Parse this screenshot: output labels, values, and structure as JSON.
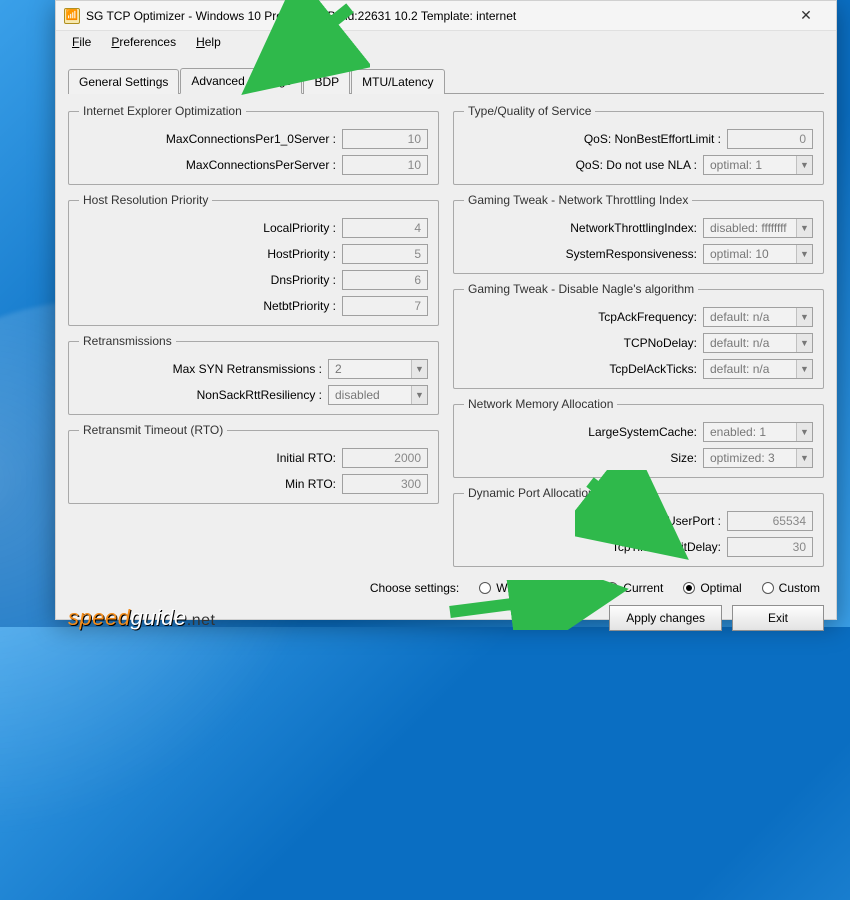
{
  "title": "SG TCP Optimizer - Windows 10 Pro (64-bit) Build:22631 10.2  Template: internet",
  "menu": {
    "file": "File",
    "preferences": "Preferences",
    "help": "Help"
  },
  "tabs": {
    "general": "General Settings",
    "advanced": "Advanced Settings",
    "bdp": "BDP",
    "mtu": "MTU/Latency"
  },
  "ie": {
    "legend": "Internet Explorer Optimization",
    "maxconn10_label": "MaxConnectionsPer1_0Server :",
    "maxconn10_value": "10",
    "maxconn_label": "MaxConnectionsPerServer :",
    "maxconn_value": "10"
  },
  "hrp": {
    "legend": "Host Resolution Priority",
    "local_label": "LocalPriority :",
    "local_value": "4",
    "host_label": "HostPriority :",
    "host_value": "5",
    "dns_label": "DnsPriority :",
    "dns_value": "6",
    "netbt_label": "NetbtPriority :",
    "netbt_value": "7"
  },
  "retr": {
    "legend": "Retransmissions",
    "maxsyn_label": "Max SYN Retransmissions :",
    "maxsyn_value": "2",
    "nonsack_label": "NonSackRttResiliency :",
    "nonsack_value": "disabled"
  },
  "rto": {
    "legend": "Retransmit Timeout (RTO)",
    "init_label": "Initial RTO:",
    "init_value": "2000",
    "min_label": "Min RTO:",
    "min_value": "300"
  },
  "qos": {
    "legend": "Type/Quality of Service",
    "nbel_label": "QoS: NonBestEffortLimit :",
    "nbel_value": "0",
    "nla_label": "QoS: Do not use NLA :",
    "nla_value": "optimal: 1"
  },
  "gtni": {
    "legend": "Gaming Tweak - Network Throttling Index",
    "nti_label": "NetworkThrottlingIndex:",
    "nti_value": "disabled: ffffffff",
    "sysresp_label": "SystemResponsiveness:",
    "sysresp_value": "optimal: 10"
  },
  "nagle": {
    "legend": "Gaming Tweak - Disable Nagle's algorithm",
    "ackfreq_label": "TcpAckFrequency:",
    "ackfreq_value": "default: n/a",
    "nodelay_label": "TCPNoDelay:",
    "nodelay_value": "default: n/a",
    "delack_label": "TcpDelAckTicks:",
    "delack_value": "default: n/a"
  },
  "nma": {
    "legend": "Network Memory Allocation",
    "lsc_label": "LargeSystemCache:",
    "lsc_value": "enabled: 1",
    "size_label": "Size:",
    "size_value": "optimized: 3"
  },
  "dpa": {
    "legend": "Dynamic Port Allocation",
    "maxup_label": "MaxUserPort :",
    "maxup_value": "65534",
    "twd_label": "TcpTimedWaitDelay:",
    "twd_value": "30"
  },
  "footer": {
    "choose_label": "Choose settings:",
    "default": "Windows Default",
    "current": "Current",
    "optimal": "Optimal",
    "custom": "Custom",
    "apply": "Apply changes",
    "exit": "Exit"
  },
  "logo": {
    "speed": "speed",
    "guide": "guide",
    "dot": ".",
    "net": "net"
  }
}
